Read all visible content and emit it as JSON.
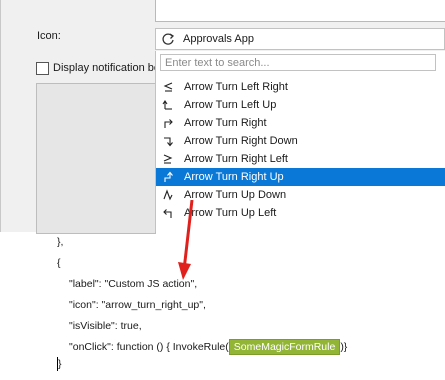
{
  "form": {
    "icon_label": "Icon:",
    "notification_label": "Display notification be",
    "combo": {
      "selected": "Approvals App",
      "icon": "refresh-icon"
    },
    "search_placeholder": "Enter text to search...",
    "items": [
      {
        "label": "Arrow Turn Left Right",
        "icon": "arrow-turn-left-right-icon",
        "selected": false
      },
      {
        "label": "Arrow Turn Left Up",
        "icon": "arrow-turn-left-up-icon",
        "selected": false
      },
      {
        "label": "Arrow Turn Right",
        "icon": "arrow-turn-right-icon",
        "selected": false
      },
      {
        "label": "Arrow Turn Right Down",
        "icon": "arrow-turn-right-down-icon",
        "selected": false
      },
      {
        "label": "Arrow Turn Right Left",
        "icon": "arrow-turn-right-left-icon",
        "selected": false
      },
      {
        "label": "Arrow Turn Right Up",
        "icon": "arrow-turn-right-up-icon",
        "selected": true
      },
      {
        "label": "Arrow Turn Up Down",
        "icon": "arrow-turn-up-down-icon",
        "selected": false
      },
      {
        "label": "Arrow Turn Up Left",
        "icon": "arrow-turn-up-left-icon",
        "selected": false
      }
    ]
  },
  "code": {
    "line0": "},",
    "line1": "{",
    "line2": "\"label\": \"Custom JS action\",",
    "line3": "\"icon\": \"arrow_turn_right_up\",",
    "line4": "\"isVisible\": true,",
    "line5_prefix": "\"onClick\": function () { InvokeRule(",
    "line5_highlight": "SomeMagicFormRule",
    "line5_suffix": ")}",
    "line6": "}"
  },
  "colors": {
    "selection": "#0a78d7",
    "annotation_arrow": "#e0201c",
    "highlight": "#92b536"
  }
}
